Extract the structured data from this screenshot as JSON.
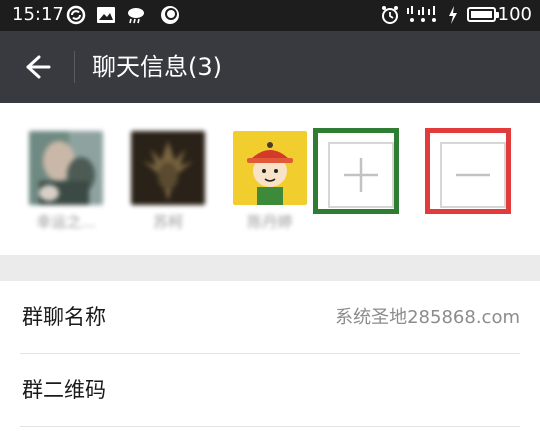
{
  "status_bar": {
    "time": "15:17",
    "battery_level": "100",
    "icons": [
      "sync-icon",
      "image-notification-icon",
      "weather-icon",
      "app-notification-icon",
      "alarm-icon",
      "signal-icon",
      "charging-icon",
      "battery-icon"
    ]
  },
  "header": {
    "title": "聊天信息(3)",
    "back_icon": "back-arrow-icon"
  },
  "members": [
    {
      "name": "幸运之...",
      "avatar": "blurred-photo-avatar"
    },
    {
      "name": "苏柯",
      "avatar": "blurred-dark-avatar"
    },
    {
      "name": "陈丹婷",
      "avatar": "cartoon-boy-avatar"
    }
  ],
  "actions": {
    "add_icon": "plus-icon",
    "remove_icon": "minus-icon",
    "add_highlight_color": "#2f7d32",
    "remove_highlight_color": "#e23b3b"
  },
  "settings": [
    {
      "label": "群聊名称",
      "value": "系统圣地285868.com"
    },
    {
      "label": "群二维码",
      "value": ""
    }
  ],
  "colors": {
    "title_bar": "#393a3f",
    "status_bar": "#1d1d1d",
    "separator": "#ebebeb"
  }
}
